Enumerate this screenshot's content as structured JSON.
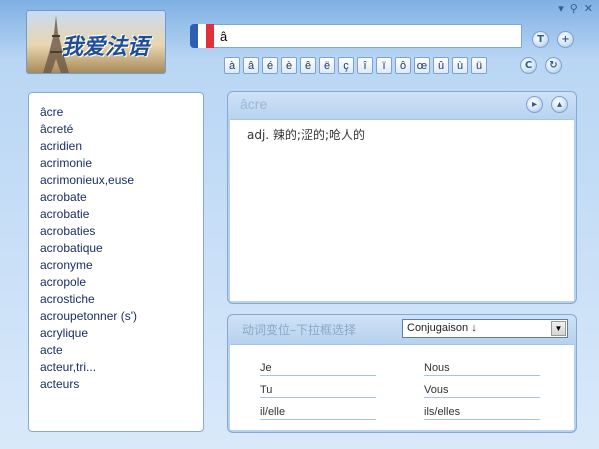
{
  "window": {
    "minimize": "▾",
    "pin": "⚲",
    "close": "✕"
  },
  "logo": {
    "text": "我爱法语"
  },
  "search": {
    "value": "â",
    "flag_colors": [
      "#2f5fb5",
      "#ffffff",
      "#e0303a"
    ]
  },
  "buttons": {
    "translate": "T",
    "add": "+",
    "c_btn": "C",
    "refresh": "↻"
  },
  "accents": [
    "à",
    "â",
    "é",
    "è",
    "ê",
    "ë",
    "ç",
    "î",
    "ï",
    "ô",
    "œ",
    "û",
    "ù",
    "ü"
  ],
  "word_list": [
    "âcre",
    "âcreté",
    "acridien",
    "acrimonie",
    "acrimonieux,euse",
    "acrobate",
    "acrobatie",
    "acrobaties",
    "acrobatique",
    "acronyme",
    "acropole",
    "acrostiche",
    "acroupetonner (s')",
    "acrylique",
    "acte",
    "acteur,tri...",
    "acteurs"
  ],
  "definition": {
    "word": "âcre",
    "text": "adj. 辣的;涩的;呛人的",
    "play_icon": "▸",
    "up_icon": "▴"
  },
  "conjugation": {
    "title": "动词变位–下拉框选择",
    "select": "Conjugaison ↓",
    "pronouns": [
      "Je",
      "Nous",
      "Tu",
      "Vous",
      "il/elle",
      "ils/elles"
    ]
  }
}
